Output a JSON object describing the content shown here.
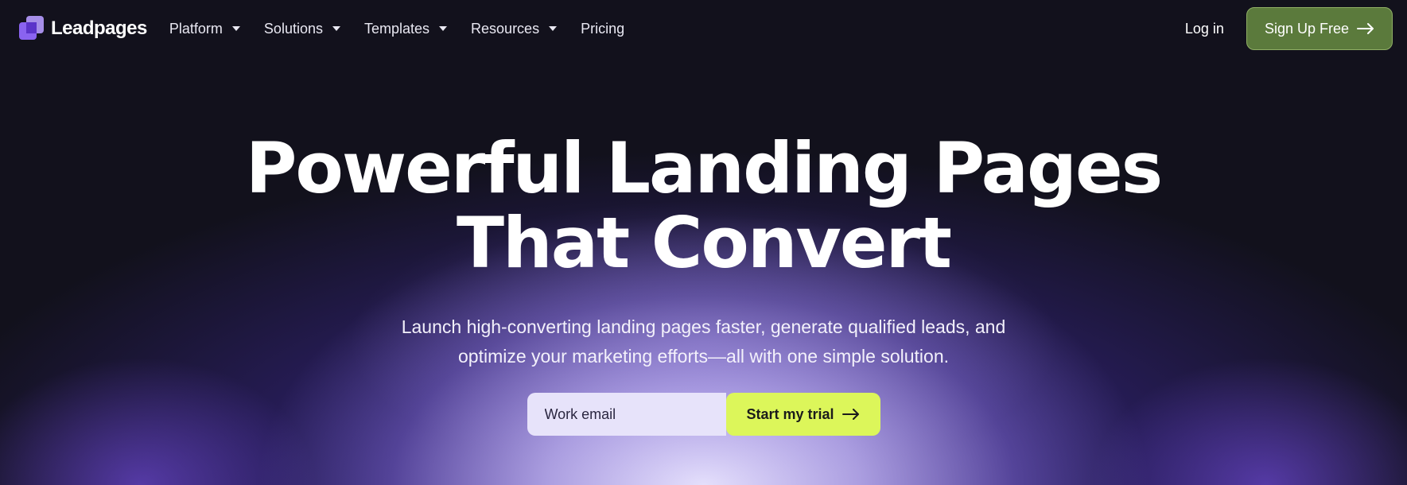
{
  "nav": {
    "brand": "Leadpages",
    "items": [
      {
        "label": "Platform",
        "has_dropdown": true
      },
      {
        "label": "Solutions",
        "has_dropdown": true
      },
      {
        "label": "Templates",
        "has_dropdown": true
      },
      {
        "label": "Resources",
        "has_dropdown": true
      },
      {
        "label": "Pricing",
        "has_dropdown": false
      }
    ],
    "login_label": "Log in",
    "signup_label": "Sign Up Free"
  },
  "hero": {
    "title_line1": "Powerful Landing Pages",
    "title_line2": "That Convert",
    "subtitle_line1": "Launch high-converting landing pages faster, generate qualified leads, and",
    "subtitle_line2": "optimize your marketing efforts—all with one simple solution.",
    "email_placeholder": "Work email",
    "cta_label": "Start my trial"
  },
  "colors": {
    "background": "#12111c",
    "signup_button": "#5b7a3c",
    "cta_button": "#dcf65a",
    "email_field": "#e7e3fa",
    "brand_purple": "#8a63f0"
  },
  "icons": {
    "logo": "leadpages-logo-icon",
    "dropdown": "caret-down-icon",
    "arrow": "arrow-right-icon"
  }
}
